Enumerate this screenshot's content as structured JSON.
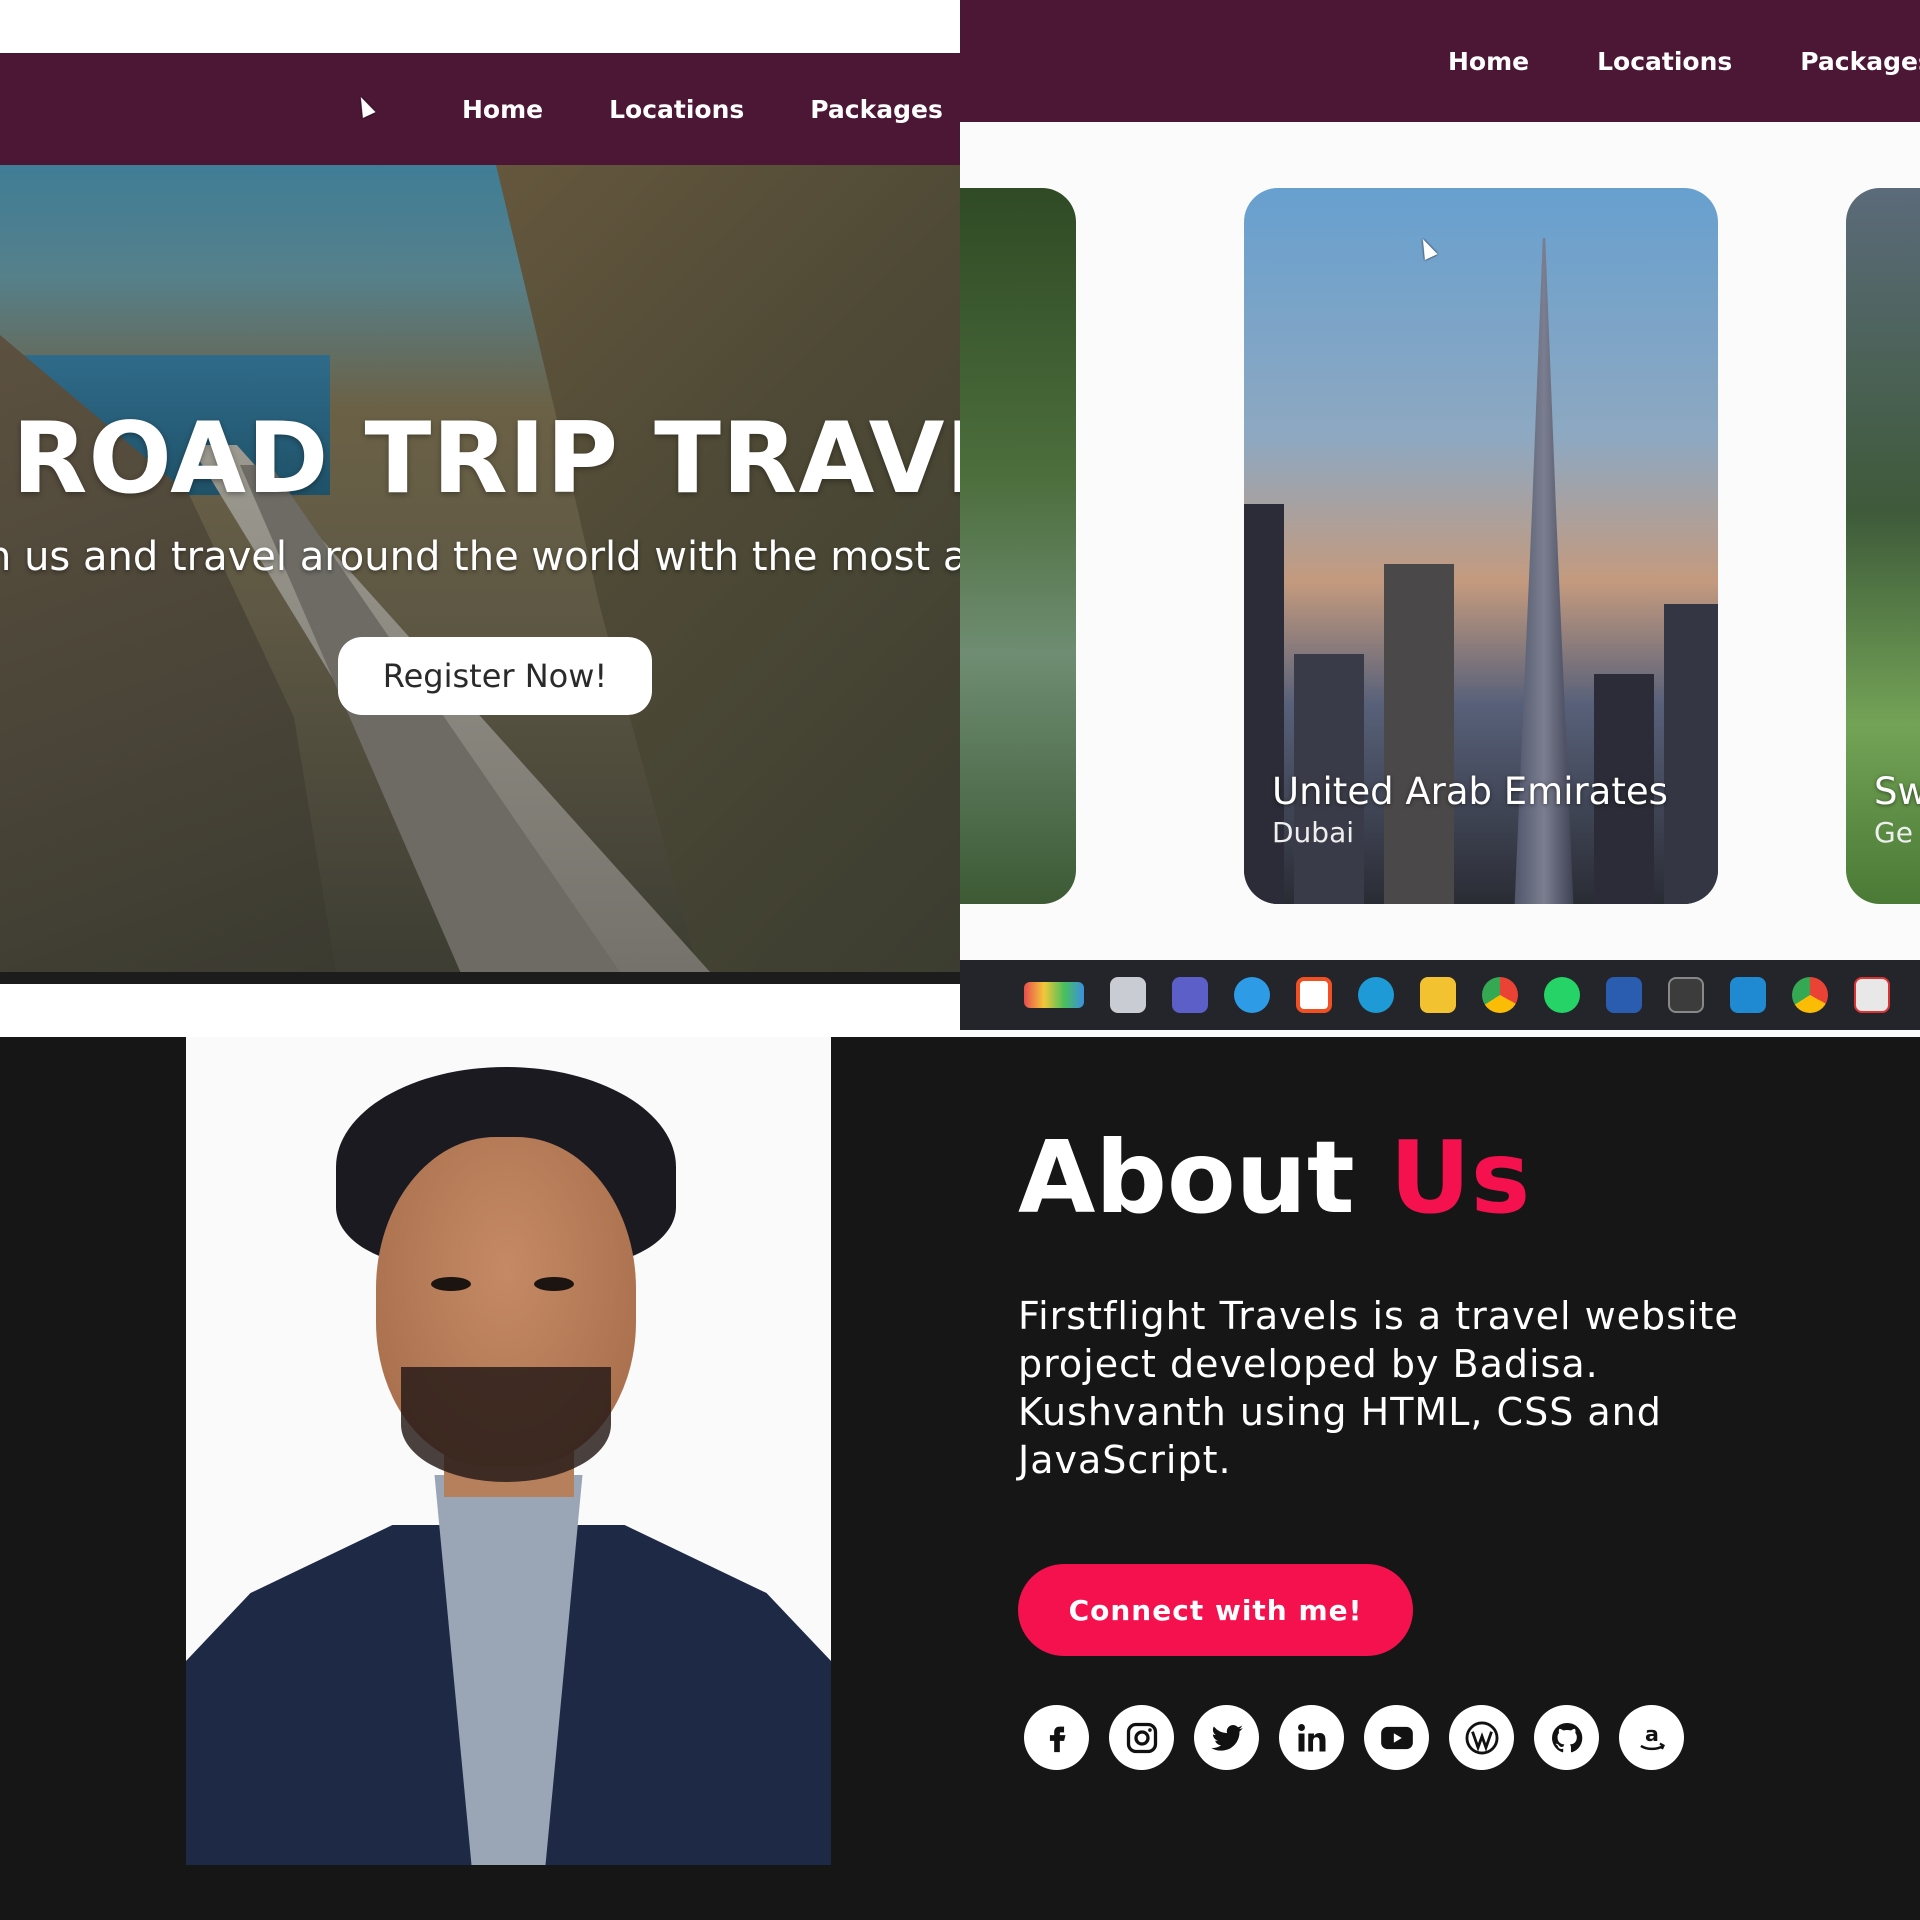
{
  "nav": {
    "items": [
      "Home",
      "Locations",
      "Packages"
    ]
  },
  "hero": {
    "title": "ROAD TRIP TRAVELS",
    "subtitle": "n us and travel around the world with the most aff",
    "cta": "Register Now!"
  },
  "locations": {
    "cards": [
      {
        "country": "",
        "city": ""
      },
      {
        "country": "United Arab Emirates",
        "city": "Dubai"
      },
      {
        "country": "Sw",
        "city": "Ge"
      }
    ]
  },
  "taskbar": {
    "icons": [
      "paint-icon",
      "files-icon",
      "teams-icon",
      "chrome-dev-icon",
      "store-icon",
      "edge-icon",
      "explorer-icon",
      "chrome-icon",
      "whatsapp-icon",
      "remote-icon",
      "terminal-icon",
      "vscode-icon",
      "chrome-icon",
      "snip-icon"
    ]
  },
  "about": {
    "title_a": "About",
    "title_b": "Us",
    "text": "Firstflight Travels is a travel website project developed by Badisa. Kushvanth using HTML, CSS and JavaScript.",
    "cta": "Connect with me!",
    "socials": [
      "facebook",
      "instagram",
      "twitter",
      "linkedin",
      "youtube",
      "wordpress",
      "github",
      "amazon"
    ]
  },
  "colors": {
    "nav_bg": "#4c1635",
    "accent": "#f4114e",
    "about_bg": "#161616"
  }
}
